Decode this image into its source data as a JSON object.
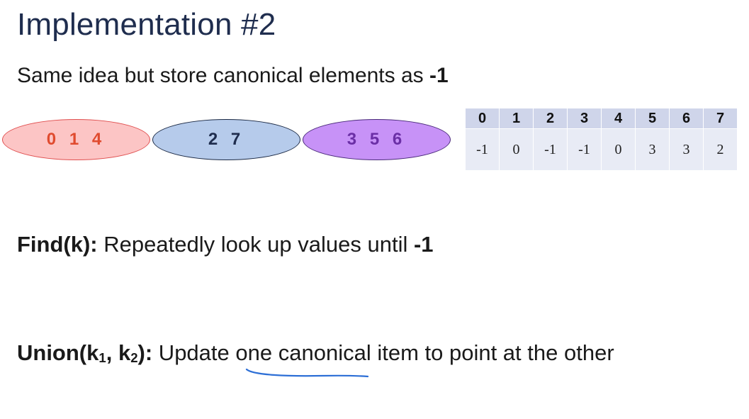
{
  "slide": {
    "title": "Implementation #2",
    "subtitle": {
      "text": "Same idea but store canonical elements as ",
      "emphasis": "-1"
    }
  },
  "sets": [
    {
      "label": "0 1 4",
      "fill": "#fcc5c5",
      "text_color": "#e04b2f"
    },
    {
      "label": "2 7",
      "fill": "#b6cbeb",
      "text_color": "#1f2d4e"
    },
    {
      "label": "3 5 6",
      "fill": "#c792f7",
      "text_color": "#6b2fa6"
    }
  ],
  "array": {
    "indices": [
      "0",
      "1",
      "2",
      "3",
      "4",
      "5",
      "6",
      "7"
    ],
    "values": [
      "-1",
      "0",
      "-1",
      "-1",
      "0",
      "3",
      "3",
      "2"
    ]
  },
  "find": {
    "label": "Find(k):",
    "text": " Repeatedly look up values until ",
    "emphasis": "-1"
  },
  "union": {
    "label_prefix": "Union(k",
    "sub1": "1",
    "label_mid": ", k",
    "sub2": "2",
    "label_suffix": "):",
    "text_before": " Update ",
    "highlighted": "one",
    "text_after": " canonical item to point at the other"
  },
  "annotation": {
    "color": "#2d6fd6"
  }
}
